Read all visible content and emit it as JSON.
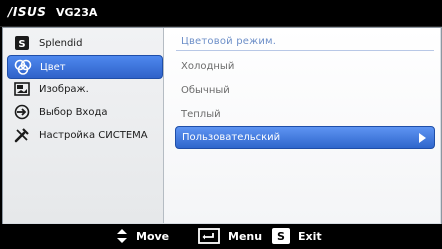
{
  "header": {
    "brand": "/ISUS",
    "model": "VG23A"
  },
  "sidebar": {
    "items": [
      {
        "label": "Splendid",
        "icon": "splendid-s-icon",
        "active": false
      },
      {
        "label": "Цвет",
        "icon": "color-palette-icon",
        "active": true
      },
      {
        "label": "Изображ.",
        "icon": "image-icon",
        "active": false
      },
      {
        "label": "Выбор Входа",
        "icon": "input-select-icon",
        "active": false
      },
      {
        "label": "Настройка СИСТЕМА",
        "icon": "tools-icon",
        "active": false
      }
    ]
  },
  "panel": {
    "title": "Цветовой режим.",
    "options": [
      {
        "label": "Холодный",
        "selected": false
      },
      {
        "label": "Обычный",
        "selected": false
      },
      {
        "label": "Теплый",
        "selected": false
      },
      {
        "label": "Пользовательский",
        "selected": true
      }
    ]
  },
  "footer": {
    "move_label": "Move",
    "menu_label": "Menu",
    "exit_label": "Exit",
    "exit_key": "S"
  },
  "colors": {
    "accent": "#2f66cc",
    "title": "#6d8fc8"
  }
}
